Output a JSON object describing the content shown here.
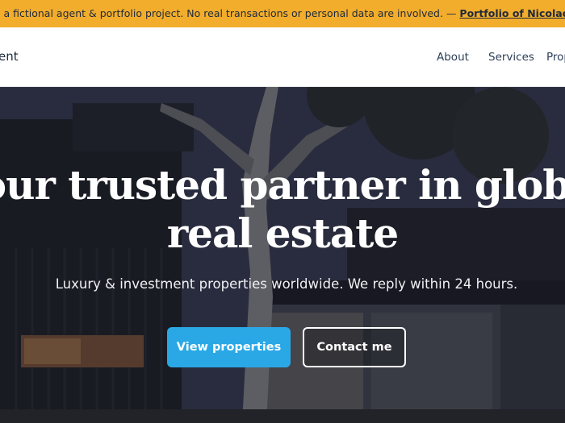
{
  "banner": {
    "text": "s a fictional agent & portfolio project. No real transactions or personal data are involved. — ",
    "link": "Portfolio of Nicolae-Valentin",
    "color": "#f2ad2c"
  },
  "nav": {
    "brand": "ent",
    "links": [
      "About",
      "Services",
      "Prop"
    ]
  },
  "hero": {
    "headline_line1": "Your trusted partner in global",
    "headline_line2": "real estate",
    "subheadline": "Luxury & investment properties worldwide. We reply within 24 hours.",
    "primary_button": "View properties",
    "secondary_button": "Contact me",
    "accent_color": "#2aa8e6"
  }
}
